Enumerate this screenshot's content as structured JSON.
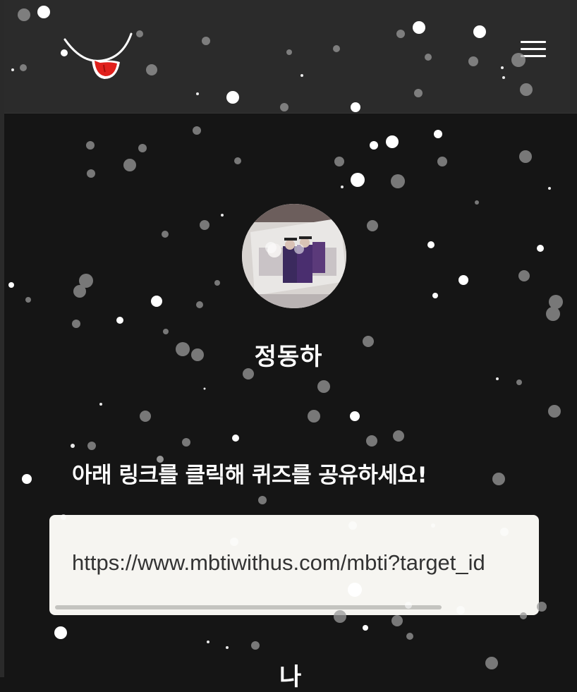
{
  "header": {
    "logo_icon": "smiley-tongue-logo",
    "menu_icon": "hamburger-menu-icon"
  },
  "profile": {
    "avatar_icon": "profile-photo",
    "name": "정동하"
  },
  "share": {
    "prompt": "아래 링크를 클릭해 퀴즈를 공유하세요!",
    "link": "https://www.mbtiwithus.com/mbti?target_id"
  },
  "next_section": {
    "title_fragment": "나"
  },
  "colors": {
    "background": "#151515",
    "header": "#2b2b2b",
    "share_box": "#f6f5f1",
    "logo_tongue": "#e0201c"
  }
}
